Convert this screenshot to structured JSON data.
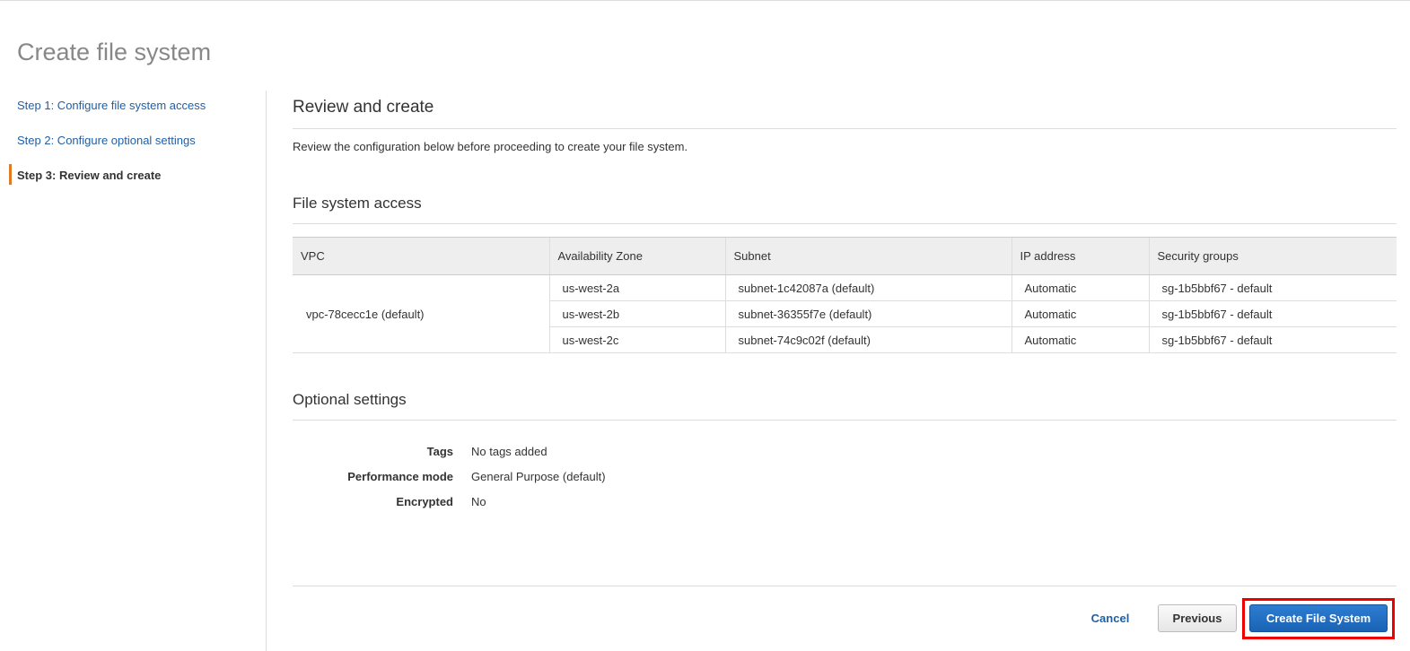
{
  "title": "Create file system",
  "steps": [
    "Step 1: Configure file system access",
    "Step 2: Configure optional settings",
    "Step 3: Review and create"
  ],
  "main": {
    "heading": "Review and create",
    "description": "Review the configuration below before proceeding to create your file system.",
    "access_heading": "File system access",
    "columns": [
      "VPC",
      "Availability Zone",
      "Subnet",
      "IP address",
      "Security groups"
    ],
    "vpc": "vpc-78cecc1e (default)",
    "rows": [
      {
        "az": "us-west-2a",
        "subnet": "subnet-1c42087a (default)",
        "ip": "Automatic",
        "sg": "sg-1b5bbf67 - default"
      },
      {
        "az": "us-west-2b",
        "subnet": "subnet-36355f7e (default)",
        "ip": "Automatic",
        "sg": "sg-1b5bbf67 - default"
      },
      {
        "az": "us-west-2c",
        "subnet": "subnet-74c9c02f (default)",
        "ip": "Automatic",
        "sg": "sg-1b5bbf67 - default"
      }
    ],
    "optional_heading": "Optional settings",
    "settings": [
      {
        "k": "Tags",
        "v": "No tags added"
      },
      {
        "k": "Performance mode",
        "v": "General Purpose (default)"
      },
      {
        "k": "Encrypted",
        "v": "No"
      }
    ]
  },
  "buttons": {
    "cancel": "Cancel",
    "previous": "Previous",
    "create": "Create File System"
  }
}
